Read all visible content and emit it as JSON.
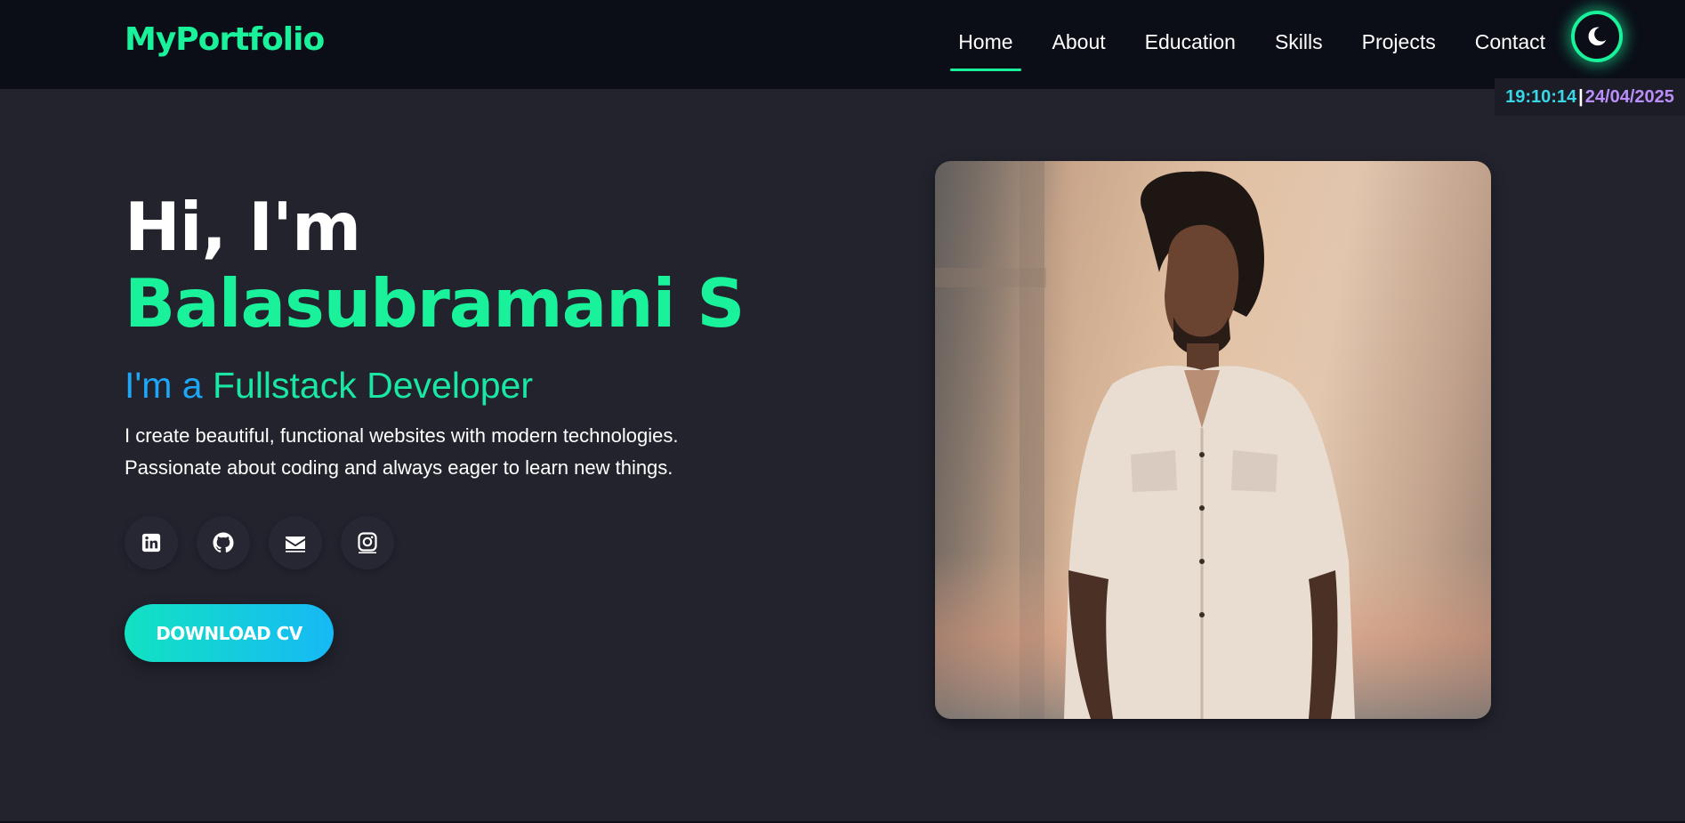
{
  "nav": {
    "logo": "MyPortfolio",
    "links": [
      {
        "label": "Home",
        "active": true
      },
      {
        "label": "About",
        "active": false
      },
      {
        "label": "Education",
        "active": false
      },
      {
        "label": "Skills",
        "active": false
      },
      {
        "label": "Projects",
        "active": false
      },
      {
        "label": "Contact",
        "active": false
      }
    ],
    "theme_toggle_icon": "moon-icon"
  },
  "clock": {
    "time": "19:10:14",
    "separator": "|",
    "date": "24/04/2025"
  },
  "hero": {
    "greeting": "Hi, I'm ",
    "name": "Balasubramani S",
    "role_prefix": "I'm a ",
    "role_title": "Fullstack Developer",
    "tagline_line1": "I create beautiful, functional websites with modern technologies.",
    "tagline_line2": "Passionate about coding and always eager to learn new things.",
    "social_icons": [
      "linkedin-icon",
      "github-icon",
      "envelope-icon",
      "instagram-icon"
    ],
    "cv_button": "DOWNLOAD CV"
  },
  "colors": {
    "accent_green": "#19f29b",
    "accent_blue": "#1ea7f7",
    "background": "#22232d",
    "navbar": "#0b0d17"
  }
}
